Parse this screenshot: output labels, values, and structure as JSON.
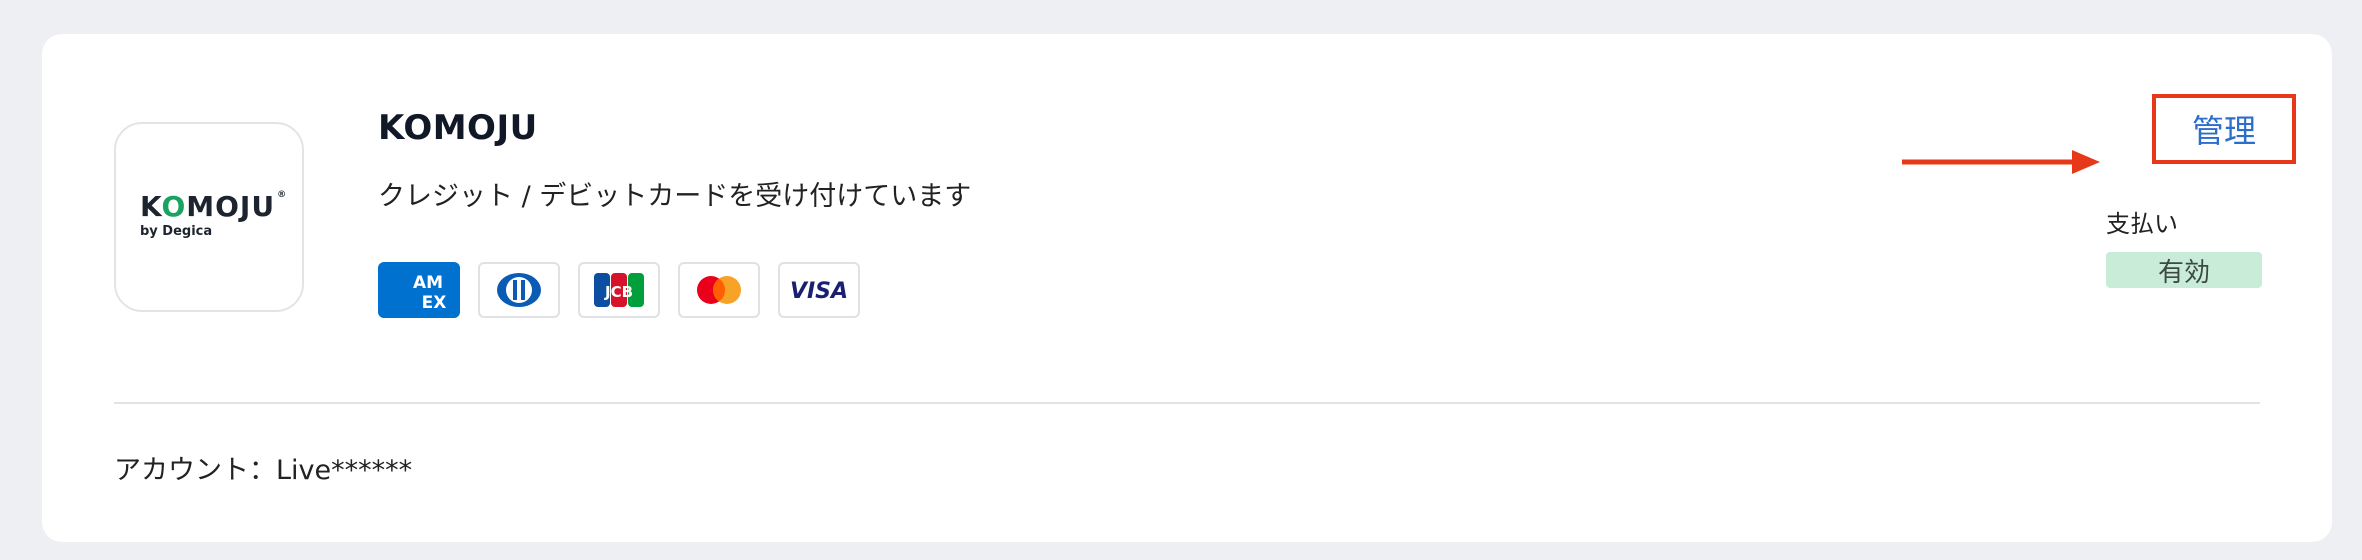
{
  "provider": {
    "logo_text_a": "K",
    "logo_text_accent": "O",
    "logo_text_b": "MOJU",
    "logo_reg": "®",
    "logo_sub": "by Degica",
    "name": "KOMOJU",
    "description": "クレジット / デビットカードを受け付けています"
  },
  "card_brands": [
    {
      "name": "American Express",
      "text_top": "AM",
      "text_bottom": "EX"
    },
    {
      "name": "Diners Club"
    },
    {
      "name": "JCB",
      "text": "JCB"
    },
    {
      "name": "Mastercard"
    },
    {
      "name": "VISA",
      "text": "VISA"
    }
  ],
  "actions": {
    "manage_label": "管理"
  },
  "payment": {
    "label": "支払い",
    "status": "有効"
  },
  "account": {
    "text": "アカウント：Live******"
  },
  "colors": {
    "accent_link": "#2c6ecb",
    "highlight": "#e8381a",
    "status_bg": "#c9ecd8"
  }
}
